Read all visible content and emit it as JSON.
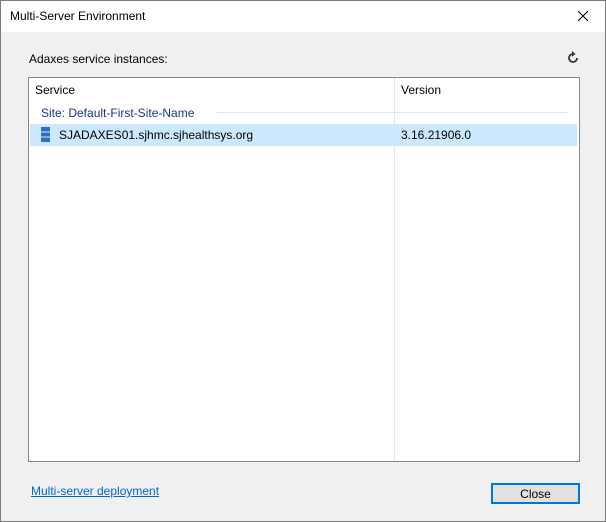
{
  "window": {
    "title": "Multi-Server Environment"
  },
  "main": {
    "section_label": "Adaxes service instances:",
    "list": {
      "columns": [
        {
          "label": "Service"
        },
        {
          "label": "Version"
        }
      ],
      "group": {
        "label": "Site: Default-First-Site-Name"
      },
      "rows": [
        {
          "service": "SJADAXES01.sjhmc.sjhealthsys.org",
          "version": "3.16.21906.0",
          "selected": true
        }
      ]
    }
  },
  "footer": {
    "link_label": "Multi-server deployment",
    "close_label": "Close"
  },
  "colors": {
    "selection": "#cce8ff",
    "group_text": "#1e3287",
    "link": "#0066cc",
    "accent": "#0078d7"
  },
  "icons": {
    "close": "close-icon",
    "refresh": "refresh-icon",
    "server": "server-icon"
  }
}
